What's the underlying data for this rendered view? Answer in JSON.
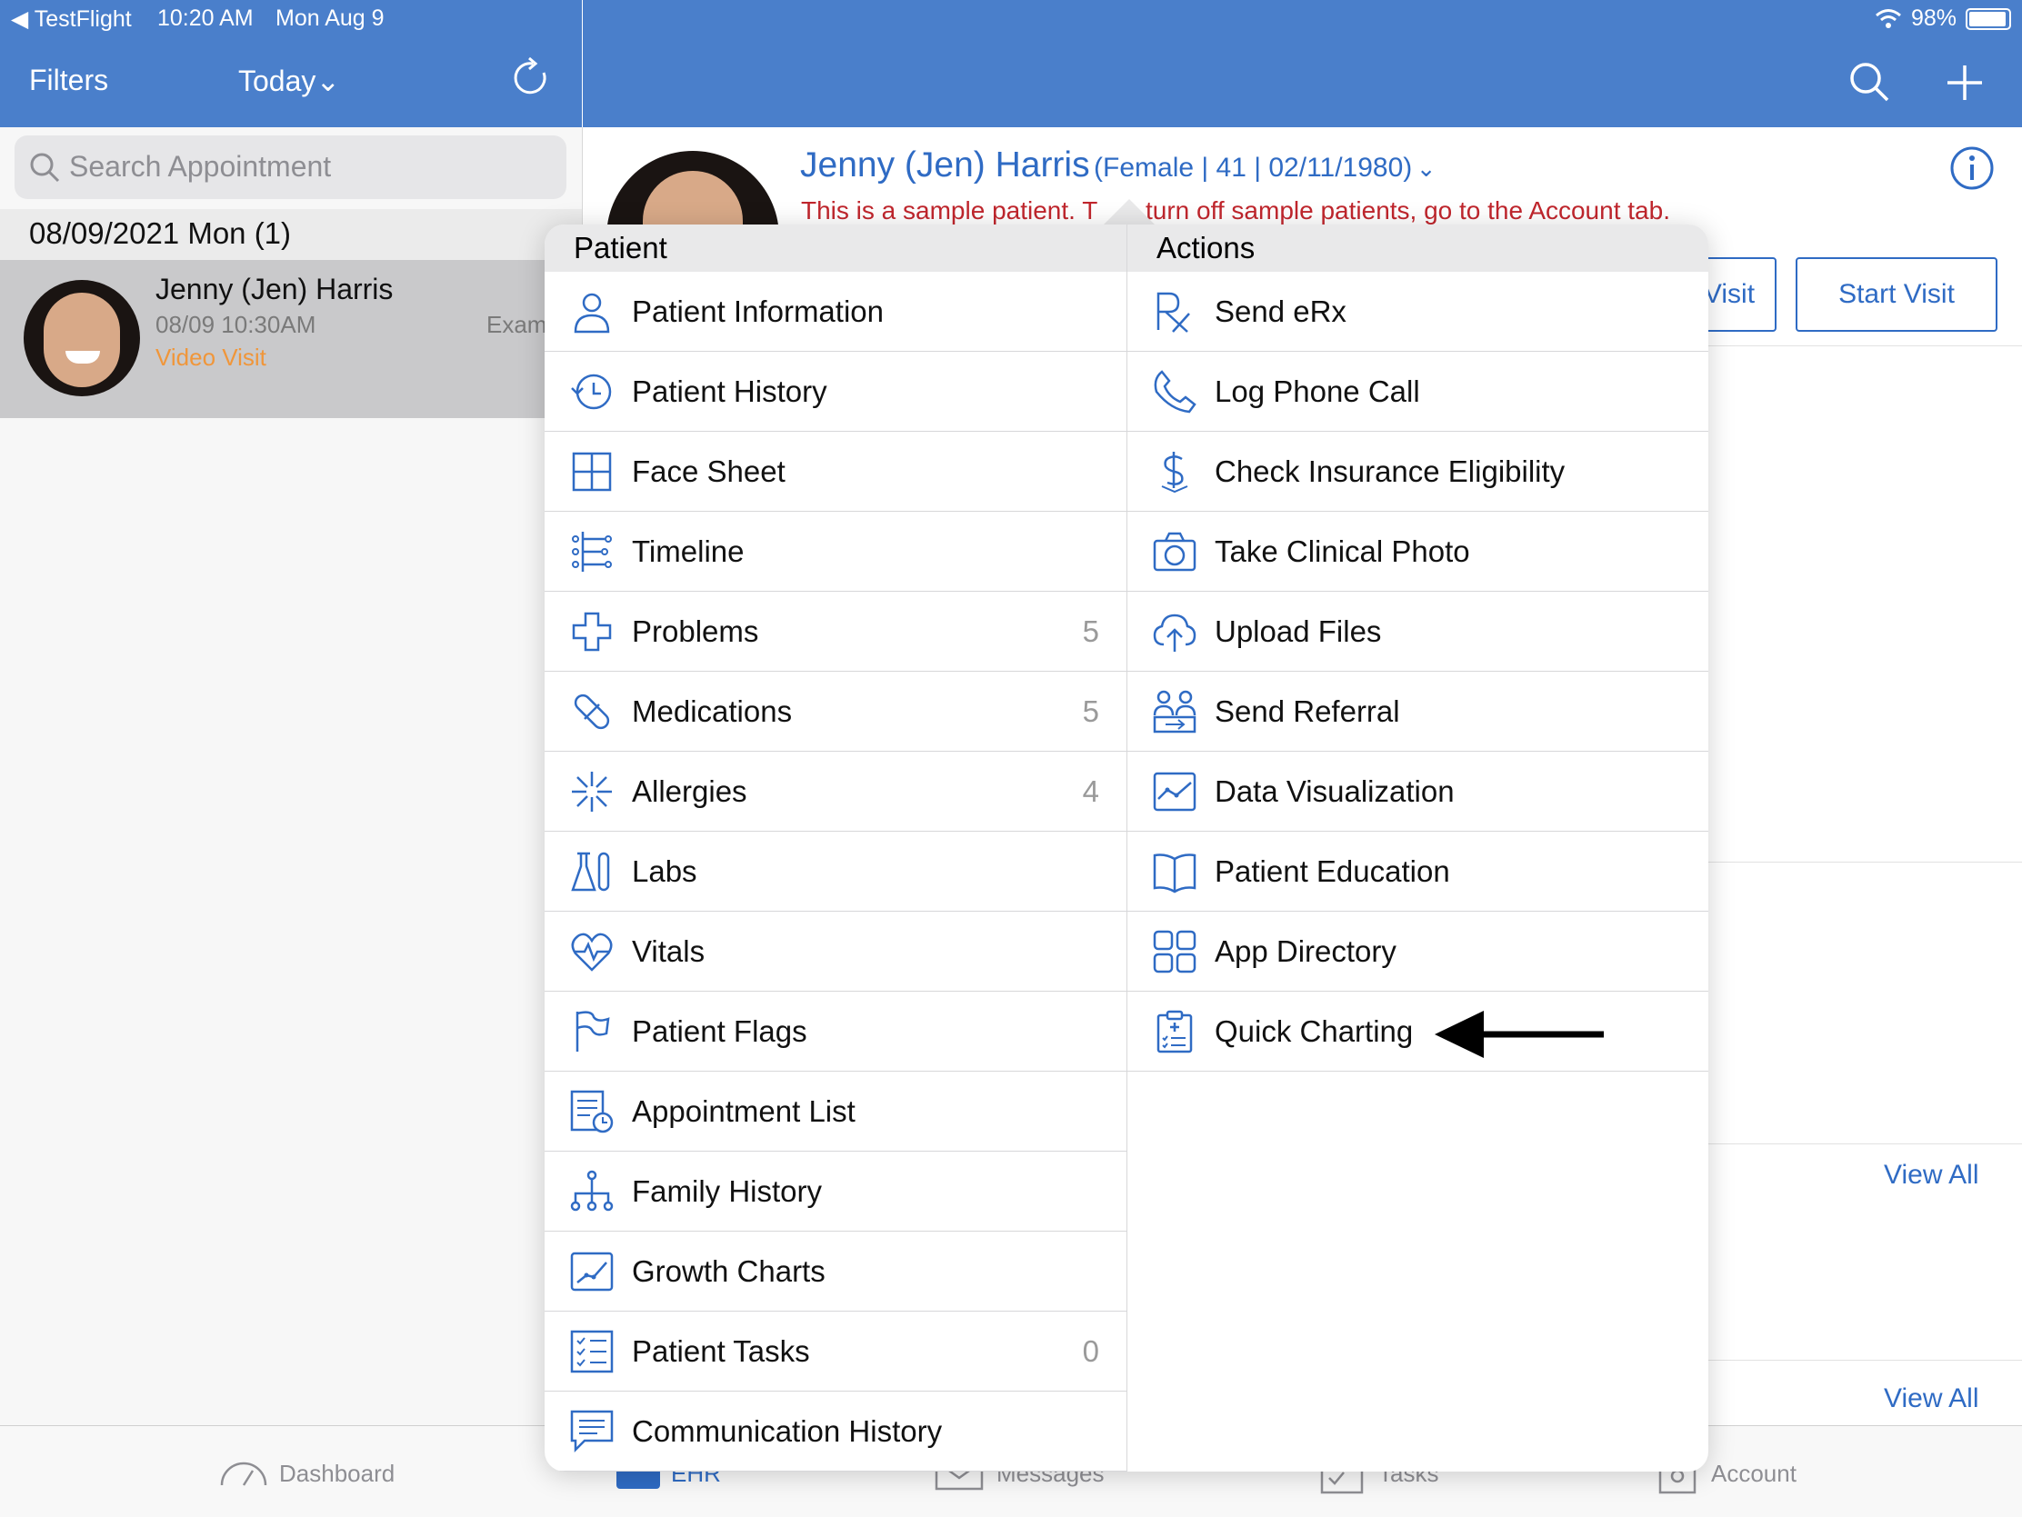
{
  "status_bar": {
    "back_app": "◀ TestFlight",
    "time": "10:20 AM",
    "date": "Mon Aug 9",
    "battery": "98%"
  },
  "nav": {
    "filters": "Filters",
    "today": "Today⌄"
  },
  "search": {
    "placeholder": "Search Appointment"
  },
  "appointments": {
    "date_header": "08/09/2021 Mon (1)",
    "item": {
      "name": "Jenny (Jen) Harris",
      "time": "08/09 10:30AM",
      "type": "Video Visit",
      "reason": "Exam"
    }
  },
  "patient": {
    "name": "Jenny (Jen) Harris",
    "details": "(Female | 41 | 02/11/1980)",
    "notice_left": "This is a sample patient. T",
    "notice_right": "turn off sample patients, go to the Account tab.",
    "visit_button": "Visit",
    "start_visit_button": "Start Visit",
    "view_all_1": "View All",
    "view_all_2": "View All"
  },
  "popover": {
    "patient_header": "Patient",
    "actions_header": "Actions",
    "patient_items": [
      {
        "label": "Patient Information",
        "count": "",
        "icon": "person-icon"
      },
      {
        "label": "Patient History",
        "count": "",
        "icon": "history-icon"
      },
      {
        "label": "Face Sheet",
        "count": "",
        "icon": "grid-icon"
      },
      {
        "label": "Timeline",
        "count": "",
        "icon": "timeline-icon"
      },
      {
        "label": "Problems",
        "count": "5",
        "icon": "medical-cross-icon"
      },
      {
        "label": "Medications",
        "count": "5",
        "icon": "pill-icon"
      },
      {
        "label": "Allergies",
        "count": "4",
        "icon": "allergy-burst-icon"
      },
      {
        "label": "Labs",
        "count": "",
        "icon": "lab-flask-icon"
      },
      {
        "label": "Vitals",
        "count": "",
        "icon": "heart-pulse-icon"
      },
      {
        "label": "Patient Flags",
        "count": "",
        "icon": "flag-icon"
      },
      {
        "label": "Appointment List",
        "count": "",
        "icon": "appointment-list-icon"
      },
      {
        "label": "Family History",
        "count": "",
        "icon": "family-tree-icon"
      },
      {
        "label": "Growth Charts",
        "count": "",
        "icon": "growth-chart-icon"
      },
      {
        "label": "Patient Tasks",
        "count": "0",
        "icon": "checklist-icon"
      },
      {
        "label": "Communication History",
        "count": "",
        "icon": "message-icon"
      }
    ],
    "action_items": [
      {
        "label": "Send eRx",
        "icon": "rx-icon"
      },
      {
        "label": "Log Phone Call",
        "icon": "phone-icon"
      },
      {
        "label": "Check Insurance Eligibility",
        "icon": "dollar-icon"
      },
      {
        "label": "Take Clinical Photo",
        "icon": "camera-icon"
      },
      {
        "label": "Upload Files",
        "icon": "cloud-upload-icon"
      },
      {
        "label": "Send Referral",
        "icon": "referral-icon"
      },
      {
        "label": "Data Visualization",
        "icon": "data-chart-icon"
      },
      {
        "label": "Patient Education",
        "icon": "book-icon"
      },
      {
        "label": "App Directory",
        "icon": "app-grid-icon"
      },
      {
        "label": "Quick Charting",
        "icon": "clipboard-icon"
      }
    ]
  },
  "tab_bar": {
    "dashboard": "Dashboard",
    "ehr": "EHR",
    "messages": "Messages",
    "tasks": "Tasks",
    "account": "Account"
  },
  "colors": {
    "accent": "#4a7fcb",
    "link": "#2f6bc4",
    "warning": "#c0262d",
    "visit_type": "#f0963a"
  }
}
